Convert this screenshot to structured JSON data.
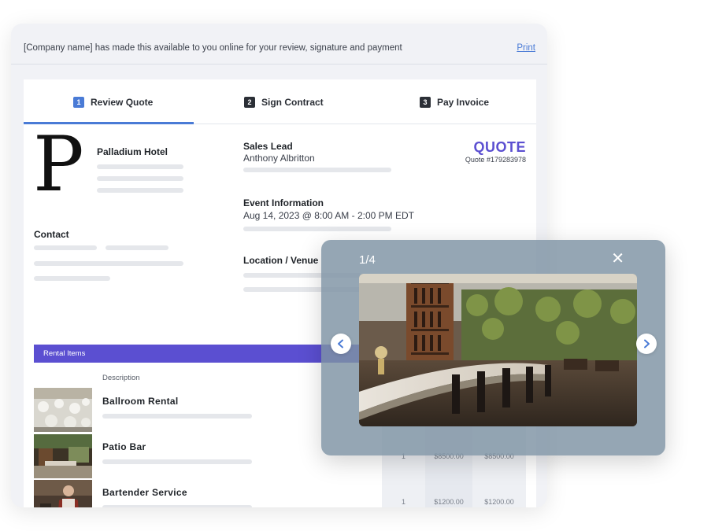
{
  "topbar": {
    "message": "[Company name] has made this available to you online for your review, signature and payment",
    "print_label": "Print"
  },
  "tabs": [
    {
      "number": "1",
      "label": "Review Quote",
      "active": true
    },
    {
      "number": "2",
      "label": "Sign Contract",
      "active": false
    },
    {
      "number": "3",
      "label": "Pay Invoice",
      "active": false
    }
  ],
  "company": {
    "logo_letter": "P",
    "name": "Palladium Hotel"
  },
  "contact": {
    "label": "Contact"
  },
  "sales_lead": {
    "label": "Sales Lead",
    "value": "Anthony Albritton"
  },
  "event_info": {
    "label": "Event Information",
    "value": "Aug 14, 2023 @ 8:00 AM - 2:00 PM EDT"
  },
  "location": {
    "label": "Location / Venue"
  },
  "quote": {
    "title": "QUOTE",
    "number": "Quote #179283978"
  },
  "rental": {
    "bar_label": "Rental Items",
    "description_header": "Description",
    "items": [
      {
        "name": "Ballroom Rental",
        "thumb_icon": "ballroom-photo",
        "qty": "",
        "price": "",
        "total": ""
      },
      {
        "name": "Patio Bar",
        "thumb_icon": "patio-bar-photo",
        "qty": "1",
        "price": "$8500.00",
        "total": "$8500.00"
      },
      {
        "name": "Bartender Service",
        "thumb_icon": "bartender-photo",
        "qty": "1",
        "price": "$1200.00",
        "total": "$1200.00"
      }
    ]
  },
  "lightbox": {
    "counter": "1/4",
    "close_icon": "close-icon",
    "prev_icon": "chevron-left-icon",
    "next_icon": "chevron-right-icon",
    "image_icon": "patio-bar-photo"
  },
  "colors": {
    "accent_blue": "#4a7bd6",
    "accent_purple": "#5b4fd1"
  }
}
